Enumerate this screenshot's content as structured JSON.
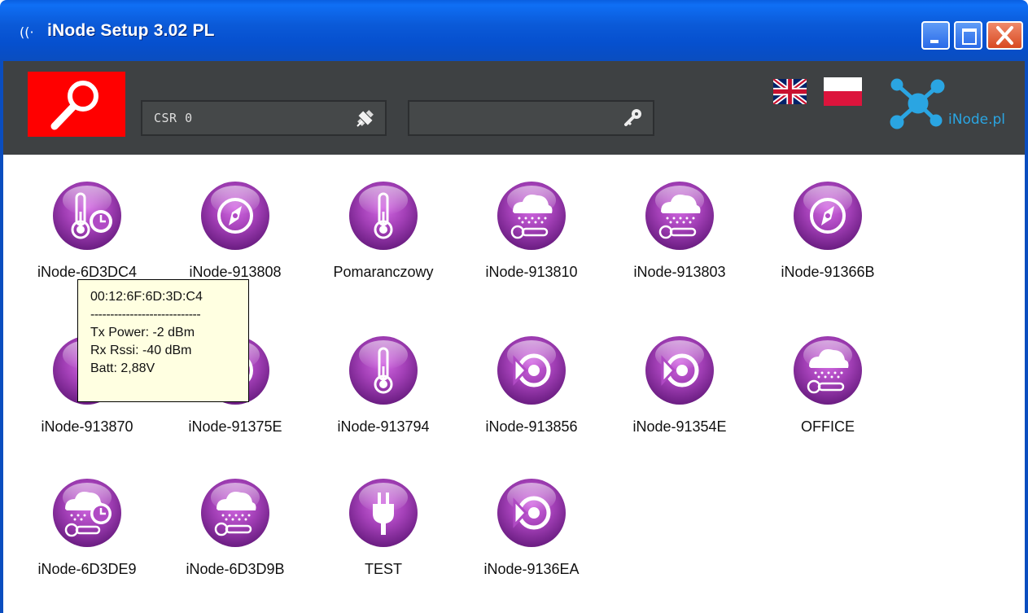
{
  "window": {
    "title": "iNode Setup 3.02 PL",
    "app_icon": "((·",
    "title_bar_color": "#0b5ad8"
  },
  "toolbar": {
    "scan_button_color": "#ff0000",
    "csr_field": {
      "value": "CSR 0",
      "icon": "satellite-icon"
    },
    "search_field": {
      "value": "",
      "placeholder": "",
      "icon": "key-icon"
    },
    "languages": [
      "uk-flag",
      "pl-flag"
    ],
    "brand": "iNode.pl",
    "brand_color": "#2aa5e2"
  },
  "devices": [
    {
      "name": "iNode-6D3DC4",
      "icon": "temperature-clock-icon"
    },
    {
      "name": "iNode-913808",
      "icon": "compass-icon"
    },
    {
      "name": "Pomaranczowy",
      "icon": "thermometer-icon"
    },
    {
      "name": "iNode-913810",
      "icon": "rain-thermometer-icon"
    },
    {
      "name": "iNode-913803",
      "icon": "rain-thermometer-icon"
    },
    {
      "name": "iNode-91366B",
      "icon": "compass-icon"
    },
    {
      "name": "iNode-913870",
      "icon": "temperature-icon"
    },
    {
      "name": "iNode-91375E",
      "icon": "compass-icon"
    },
    {
      "name": "iNode-913794",
      "icon": "thermometer-icon"
    },
    {
      "name": "iNode-913856",
      "icon": "beacon-icon"
    },
    {
      "name": "iNode-91354E",
      "icon": "beacon-icon"
    },
    {
      "name": "OFFICE",
      "icon": "rain-thermometer-icon"
    },
    {
      "name": "iNode-6D3DE9",
      "icon": "rain-clock-icon"
    },
    {
      "name": "iNode-6D3D9B",
      "icon": "rain-thermometer-icon"
    },
    {
      "name": "TEST",
      "icon": "plug-icon"
    },
    {
      "name": "iNode-9136EA",
      "icon": "beacon-icon"
    }
  ],
  "tooltip": {
    "mac": "00:12:6F:6D:3D:C4",
    "separator": "----------------------------",
    "tx_power": "Tx Power: -2 dBm",
    "rx_rssi": "Rx Rssi: -40 dBm",
    "batt": "Batt: 2,88V"
  },
  "colors": {
    "icon_purple": "#a23fb6",
    "toolbar_bg": "#3e4143",
    "tooltip_bg": "#ffffe1"
  }
}
